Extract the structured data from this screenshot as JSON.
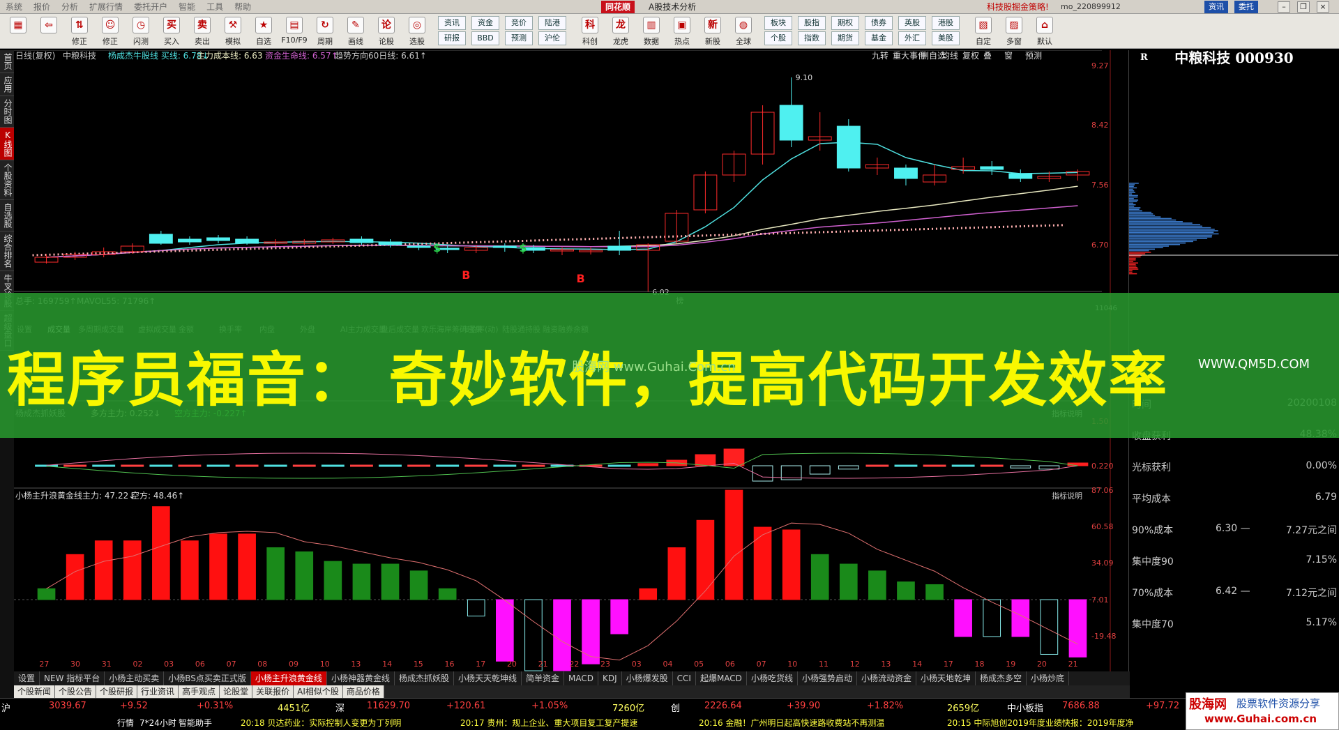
{
  "menubar": {
    "items": [
      "系统",
      "报价",
      "分析",
      "扩展行情",
      "委托开户",
      "智能",
      "工具",
      "帮助"
    ],
    "logo": "同花顺",
    "title": "A股技术分析",
    "promo": "科技股掘金策略!",
    "account": "mo_220899912",
    "btn_info": "资讯",
    "btn_trade": "委托"
  },
  "toolbar": {
    "items": [
      {
        "icon": "windows-icon",
        "glyph": "▦",
        "label": ""
      },
      {
        "icon": "back-arrow-icon",
        "glyph": "⇦",
        "label": ""
      },
      {
        "icon": "up-down-icon",
        "glyph": "⇅",
        "label": "修正"
      },
      {
        "icon": "smile-icon",
        "glyph": "☺",
        "label": "修正"
      },
      {
        "icon": "clock-icon",
        "glyph": "◷",
        "label": "闪测"
      },
      {
        "icon": "buy-icon",
        "glyph": "买",
        "label": "买入"
      },
      {
        "icon": "sell-icon",
        "glyph": "卖",
        "label": "卖出"
      },
      {
        "icon": "hammer-icon",
        "glyph": "⚒",
        "label": "模拟"
      },
      {
        "icon": "self-select-icon",
        "glyph": "★",
        "label": "自选"
      },
      {
        "icon": "f10-icon",
        "glyph": "▤",
        "label": "F10/F9"
      },
      {
        "icon": "period-icon",
        "glyph": "↻",
        "label": "周期"
      },
      {
        "icon": "draw-icon",
        "glyph": "✎",
        "label": "画线"
      },
      {
        "icon": "stock-discussion-icon",
        "glyph": "论",
        "label": "论股"
      },
      {
        "icon": "stock-pick-icon",
        "glyph": "◎",
        "label": "选股"
      }
    ],
    "small_buttons": [
      [
        "资讯",
        "研报"
      ],
      [
        "资金",
        "BBD"
      ],
      [
        "竞价",
        "预测"
      ],
      [
        "陆港",
        "沪伦"
      ]
    ],
    "items2": [
      {
        "icon": "kechuang-icon",
        "glyph": "科",
        "label": "科创"
      },
      {
        "icon": "dragon-tiger-icon",
        "glyph": "龙",
        "label": "龙虎"
      },
      {
        "icon": "data-icon",
        "glyph": "▥",
        "label": "数据"
      },
      {
        "icon": "hotspot-icon",
        "glyph": "▣",
        "label": "热点"
      },
      {
        "icon": "new-stock-icon",
        "glyph": "新",
        "label": "新股"
      },
      {
        "icon": "globe-icon",
        "glyph": "◍",
        "label": "全球"
      }
    ],
    "small_buttons2": [
      [
        "板块",
        "个股"
      ],
      [
        "股指",
        "指数"
      ],
      [
        "期权",
        "期货"
      ],
      [
        "债券",
        "基金"
      ],
      [
        "英股",
        "外汇"
      ],
      [
        "港股",
        "美股"
      ]
    ],
    "items3": [
      {
        "icon": "custom-icon",
        "glyph": "▧",
        "label": "自定"
      },
      {
        "icon": "multi-window-icon",
        "glyph": "▨",
        "label": "多窗"
      },
      {
        "icon": "home-icon",
        "glyph": "⌂",
        "label": "默认"
      }
    ]
  },
  "sidetabs": [
    "首页",
    "应用",
    "分时图",
    "K线图",
    "个股资料",
    "自选股",
    "综合排名",
    "牛叉诊股",
    "超级盘口"
  ],
  "kline": {
    "title": "日线(复权)",
    "stock": "中粮科技",
    "ind1": "杨成杰牛股线 买线: 6.78↓",
    "ind2": "主力成本线: 6.63",
    "ind3": "资金生命线: 6.57↑",
    "ind4": "趋势方向60日线: 6.61↑",
    "buttons": [
      "九转",
      "重大事件",
      "删自选",
      "均线",
      "复权",
      "叠",
      "窗",
      "预测"
    ],
    "yticks": [
      "9.27",
      "8.42",
      "7.56",
      "6.70"
    ],
    "high_label": "9.10",
    "low_label": "6.02",
    "signal_b": "B",
    "signal_s": "$",
    "small_tag": "榜",
    "candles": [
      [
        6.45,
        6.52,
        6.56,
        6.43
      ],
      [
        6.52,
        6.56,
        6.6,
        6.48
      ],
      [
        6.56,
        6.6,
        6.66,
        6.52
      ],
      [
        6.6,
        6.68,
        6.72,
        6.57
      ],
      [
        6.85,
        6.72,
        6.9,
        6.7
      ],
      [
        6.78,
        6.74,
        6.82,
        6.7
      ],
      [
        6.8,
        6.76,
        6.84,
        6.72
      ],
      [
        6.78,
        6.72,
        6.82,
        6.7
      ],
      [
        6.72,
        6.74,
        6.78,
        6.68
      ],
      [
        6.72,
        6.75,
        6.78,
        6.7
      ],
      [
        6.74,
        6.77,
        6.8,
        6.71
      ],
      [
        6.78,
        6.73,
        6.82,
        6.7
      ],
      [
        6.74,
        6.7,
        6.78,
        6.66
      ],
      [
        6.68,
        6.66,
        6.72,
        6.62
      ],
      [
        6.65,
        6.63,
        6.69,
        6.58
      ],
      [
        6.62,
        6.66,
        6.7,
        6.58
      ],
      [
        6.68,
        6.66,
        6.72,
        6.6
      ],
      [
        6.66,
        6.62,
        6.7,
        6.58
      ],
      [
        6.62,
        6.63,
        6.66,
        6.55
      ],
      [
        6.6,
        6.62,
        6.66,
        6.56
      ],
      [
        6.68,
        6.62,
        6.9,
        6.55
      ],
      [
        6.62,
        6.7,
        6.72,
        6.02
      ],
      [
        6.75,
        7.15,
        7.2,
        6.72
      ],
      [
        7.2,
        7.7,
        7.75,
        7.15
      ],
      [
        7.7,
        8.0,
        8.05,
        7.6
      ],
      [
        8.0,
        8.6,
        8.7,
        7.85
      ],
      [
        8.7,
        8.2,
        9.1,
        8.1
      ],
      [
        8.2,
        8.25,
        8.6,
        8.05
      ],
      [
        8.4,
        7.8,
        8.5,
        7.75
      ],
      [
        7.8,
        7.85,
        7.95,
        7.7
      ],
      [
        7.8,
        7.65,
        7.85,
        7.55
      ],
      [
        7.6,
        7.7,
        7.85,
        7.55
      ],
      [
        7.78,
        7.82,
        7.95,
        7.72
      ],
      [
        7.82,
        7.78,
        7.9,
        7.7
      ],
      [
        7.72,
        7.65,
        7.78,
        7.6
      ],
      [
        7.65,
        7.68,
        7.75,
        7.6
      ],
      [
        7.7,
        7.75,
        7.78,
        7.62
      ]
    ]
  },
  "volume": {
    "label1": "总手: 169759↑",
    "label2": "MAVOL55: 71796↑",
    "ytick": "11046",
    "tabs": [
      "设置",
      "成交量",
      "多周期成交量",
      "虚拟成交量",
      "金额",
      "换手率",
      "内盘",
      "外盘",
      "AI主力成交量",
      "盘后成交量",
      "欢乐海岸筹码密集",
      "市盈率(动)",
      "陆股通持股",
      "融资融券余额"
    ],
    "side": [
      "指标说明",
      "指标说明"
    ]
  },
  "macd": {
    "title": "杨成杰抓妖股",
    "ind1": "多方主力: 0.252↓",
    "ind2": "空方主力: -0.227↑",
    "ytick_top": "1.50",
    "ytick": "0.220",
    "btn": "指标说明",
    "values": [
      0.02,
      0.03,
      0.04,
      0.05,
      0.05,
      0.04,
      0.03,
      0.02,
      0.01,
      0.0,
      -0.01,
      -0.01,
      -0.02,
      -0.02,
      -0.01,
      -0.02,
      -0.01,
      -0.01,
      -0.02,
      -0.02,
      -0.02,
      0.08,
      0.2,
      0.4,
      0.6,
      -0.55,
      -0.5,
      -0.3,
      -0.12,
      -0.05,
      -0.02,
      -0.03,
      -0.04,
      -0.05,
      -0.08,
      -0.12,
      0.1
    ]
  },
  "golden": {
    "title": "小杨主升浪黄金线",
    "ind1": "主力: 47.22↓",
    "ind2": "空方: 48.46↑",
    "btn": "指标说明",
    "yticks": [
      "87.06",
      "60.58",
      "34.09",
      "7.01",
      "-19.48"
    ],
    "bars": [
      [
        15,
        "g"
      ],
      [
        40,
        "r"
      ],
      [
        50,
        "r"
      ],
      [
        50,
        "r"
      ],
      [
        75,
        "r"
      ],
      [
        50,
        "r"
      ],
      [
        55,
        "r"
      ],
      [
        55,
        "r"
      ],
      [
        45,
        "g"
      ],
      [
        42,
        "g"
      ],
      [
        35,
        "g"
      ],
      [
        33,
        "g"
      ],
      [
        33,
        "g"
      ],
      [
        28,
        "g"
      ],
      [
        15,
        "g"
      ],
      [
        -5,
        "w"
      ],
      [
        -38,
        "m"
      ],
      [
        -45,
        "w"
      ],
      [
        -45,
        "m"
      ],
      [
        -40,
        "m"
      ],
      [
        -18,
        "m"
      ],
      [
        15,
        "r"
      ],
      [
        45,
        "r"
      ],
      [
        65,
        "r"
      ],
      [
        87,
        "r"
      ],
      [
        60,
        "r"
      ],
      [
        58,
        "r"
      ],
      [
        40,
        "g"
      ],
      [
        33,
        "g"
      ],
      [
        28,
        "g"
      ],
      [
        20,
        "g"
      ],
      [
        18,
        "g"
      ],
      [
        -20,
        "m"
      ],
      [
        -20,
        "w"
      ],
      [
        -20,
        "m"
      ],
      [
        -33,
        "w"
      ],
      [
        -35,
        "m"
      ]
    ],
    "xlabels": [
      "27",
      "30",
      "31",
      "02",
      "03",
      "06",
      "07",
      "08",
      "09",
      "10",
      "13",
      "14",
      "15",
      "16",
      "17",
      "20",
      "21",
      "22",
      "23",
      "03",
      "04",
      "05",
      "06",
      "07",
      "10",
      "11",
      "12",
      "13",
      "14",
      "17",
      "18",
      "19",
      "20",
      "21"
    ]
  },
  "quote": {
    "name": "中粮科技 000930",
    "r": "R",
    "rows": [
      [
        "时间",
        "",
        "20200108"
      ],
      [
        "收盘获利",
        "",
        "48.38%"
      ],
      [
        "光标获利",
        "",
        "0.00%"
      ],
      [
        "平均成本",
        "",
        "6.79"
      ],
      [
        "90%成本",
        "6.30 —",
        "7.27元之间"
      ],
      [
        "集中度90",
        "",
        "7.15%"
      ],
      [
        "70%成本",
        "6.42 —",
        "7.12元之间"
      ],
      [
        "集中度70",
        "",
        "5.17%"
      ]
    ]
  },
  "overlay": {
    "text": "程序员福音： 奇妙软件，提高代码开发效率",
    "wm1": "股海网 www.Guhai.Com.cn",
    "wm2": "WWW.QM5D.COM"
  },
  "bottomtabs": [
    "设置",
    "NEW 指标平台",
    "小杨主动买卖",
    "小杨BS点买卖正式版",
    "小杨主升浪黄金线",
    "小杨神器黄金线",
    "杨成杰抓妖股",
    "小杨天天乾坤线",
    "简单资金",
    "MACD",
    "KDJ",
    "小杨爆发股",
    "CCI",
    "起爆MACD",
    "小杨吃货线",
    "小杨强势启动",
    "小杨流动资金",
    "小杨天地乾坤",
    "杨成杰多空",
    "小杨炒底"
  ],
  "newsbar": [
    "个股新闻",
    "个股公告",
    "个股研报",
    "行业资讯",
    "高手观点",
    "论股堂",
    "关联报价",
    "AI相似个股",
    "商品价格"
  ],
  "ticker": {
    "i1": "沪",
    "v1": "3039.67",
    "c1": "+9.52",
    "p1": "+0.31%",
    "a1": "4451亿",
    "i2": "深",
    "v2": "11629.70",
    "c2": "+120.61",
    "p2": "+1.05%",
    "a2": "7260亿",
    "i3": "创",
    "v3": "2226.64",
    "c3": "+39.90",
    "p3": "+1.82%",
    "a3": "2659亿",
    "i4": "中小板指",
    "v4": "7686.88",
    "c4": "+97.72"
  },
  "statusbar": {
    "s1": "行情",
    "s2": "7*24小时",
    "s3": "智能助手",
    "n1": "20:18 贝达药业：实际控制人变更为丁列明",
    "n2": "20:17 贵州：规上企业、重大项目复工复产提速",
    "n3": "20:16 金融！广州明日起高快速路收费站不再测温",
    "n4": "20:15 中际旭创2019年度业绩快报：2019年度净"
  },
  "guhai": {
    "g1": "股海网",
    "g2": "股票软件资源分享",
    "g3": "www.Guhai.com.cn"
  },
  "colors": {
    "up": "#ff2b2b",
    "down": "#4ff0f0",
    "ma1": "#4fe0e0",
    "ma2": "#e8e8c0",
    "ma3": "#d060d0",
    "dot": "#ffb0b0",
    "green_bar": "#1a8a1a",
    "magenta": "#ff10ff",
    "overlay_text": "#f8f800"
  }
}
